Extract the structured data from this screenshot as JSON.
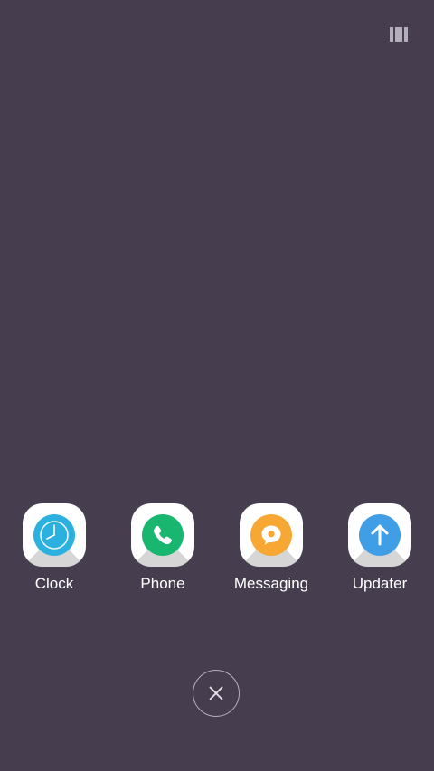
{
  "theme": {
    "background": "#463e4f",
    "tile": "#ffffff",
    "label_color": "#ffffff"
  },
  "header": {
    "layout_toggle_icon": "grid-layout-icon"
  },
  "dock": {
    "apps": [
      {
        "label": "Clock",
        "icon": "clock-icon",
        "color": "#2bb0e0"
      },
      {
        "label": "Phone",
        "icon": "phone-icon",
        "color": "#18b66f"
      },
      {
        "label": "Messaging",
        "icon": "chat-bubble-icon",
        "color": "#f7a733"
      },
      {
        "label": "Updater",
        "icon": "arrow-up-icon",
        "color": "#3f9ee6"
      }
    ]
  },
  "footer": {
    "close_icon": "close-icon"
  }
}
